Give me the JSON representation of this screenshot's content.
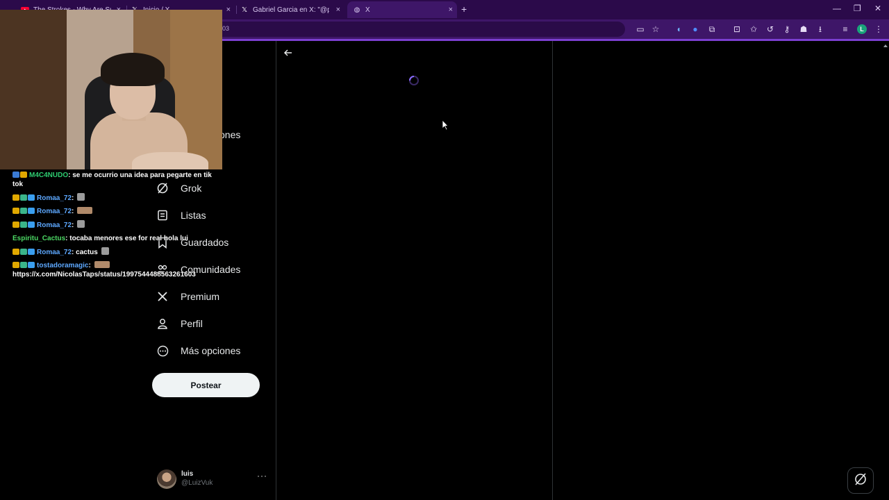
{
  "browser": {
    "tabs": [
      {
        "title": "The Strokes - Why Are Sunday",
        "favicon": "youtube-icon",
        "active": false
      },
      {
        "title": "Inicio / X",
        "favicon": "x-logo-icon",
        "active": false
      },
      {
        "title": "Gabriel Garcia en X: \"@porque",
        "favicon": "x-logo-icon",
        "active": false
      },
      {
        "title": "X",
        "favicon": "globe-icon",
        "active": true
      }
    ],
    "tab_close": "×",
    "new_tab": "+",
    "address_fragment": "03",
    "window_controls": {
      "minimize": "—",
      "restore": "❐",
      "close": "✕"
    },
    "profile_initial": "L",
    "accent": "#3e1668"
  },
  "sidebar": {
    "partial_label": "ones",
    "items": [
      {
        "label": "Grok",
        "icon": "grok-icon"
      },
      {
        "label": "Listas",
        "icon": "list-icon"
      },
      {
        "label": "Guardados",
        "icon": "bookmark-icon"
      },
      {
        "label": "Comunidades",
        "icon": "communities-icon"
      },
      {
        "label": "Premium",
        "icon": "x-logo-icon"
      },
      {
        "label": "Perfil",
        "icon": "profile-icon"
      },
      {
        "label": "Más opciones",
        "icon": "more-circle-icon"
      }
    ],
    "post_button": "Postear"
  },
  "account": {
    "name": "luis",
    "handle": "@LuizVuk",
    "more": "···"
  },
  "chat": [
    {
      "user": "M4C4NUDO",
      "sep": ": ",
      "message": "se me ocurrio una idea para pegarte en tik tok",
      "color": "green",
      "emote": false
    },
    {
      "user": "Romaa_72",
      "sep": ": ",
      "message": "",
      "color": "blue",
      "emote": "small"
    },
    {
      "user": "Romaa_72",
      "sep": ": ",
      "message": "",
      "color": "blue",
      "emote": "wide"
    },
    {
      "user": "Romaa_72",
      "sep": ": ",
      "message": "",
      "color": "blue",
      "emote": "small"
    },
    {
      "user": "Espiritu_Cactus",
      "sep": ": ",
      "message": "tocaba menores ese for real hola lui",
      "color": "cactus",
      "emote": false
    },
    {
      "user": "Romaa_72",
      "sep": ": ",
      "message": "cactus",
      "color": "blue",
      "emote": "small"
    },
    {
      "user": "tostadoramagic",
      "sep": ": ",
      "message": "https://x.com/NicolasTaps/status/1997544488563261603",
      "color": "blue",
      "emote": "wide"
    }
  ]
}
